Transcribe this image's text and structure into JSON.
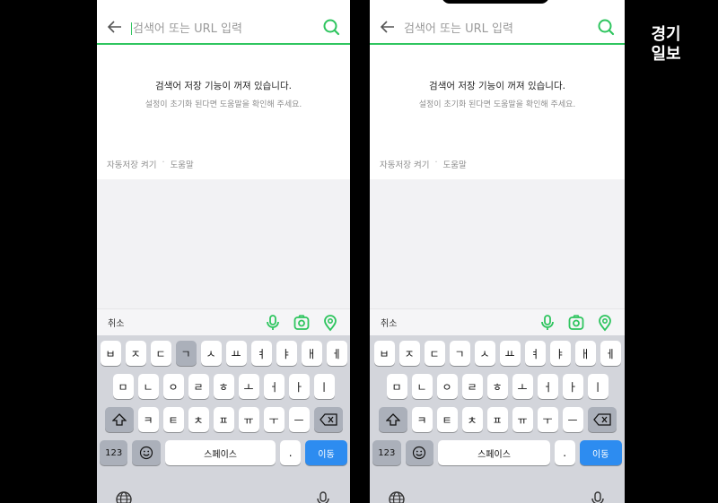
{
  "search": {
    "placeholder": "검색어 또는 URL 입력"
  },
  "notice": {
    "title": "검색어 저장 기능이 꺼져 있습니다.",
    "subtitle": "설정이 초기화 된다면 도움말을 확인해 주세요."
  },
  "footer": {
    "autosave_label": "자동저장 켜기",
    "separator": "·",
    "help_label": "도움말"
  },
  "accessory": {
    "cancel_label": "취소"
  },
  "keyboard": {
    "row1": [
      "ㅂ",
      "ㅈ",
      "ㄷ",
      "ㄱ",
      "ㅅ",
      "ㅛ",
      "ㅕ",
      "ㅑ",
      "ㅐ",
      "ㅔ"
    ],
    "row2": [
      "ㅁ",
      "ㄴ",
      "ㅇ",
      "ㄹ",
      "ㅎ",
      "ㅗ",
      "ㅓ",
      "ㅏ",
      "ㅣ"
    ],
    "row3": [
      "ㅋ",
      "ㅌ",
      "ㅊ",
      "ㅍ",
      "ㅠ",
      "ㅜ",
      "ㅡ"
    ],
    "num_label": "123",
    "space_label": "스페이스",
    "period_label": ".",
    "go_label": "이동"
  },
  "logo": {
    "line1": "경기",
    "line2": "일보"
  },
  "colors": {
    "accent": "#2fc55f",
    "go_button": "#2d8cf0"
  }
}
